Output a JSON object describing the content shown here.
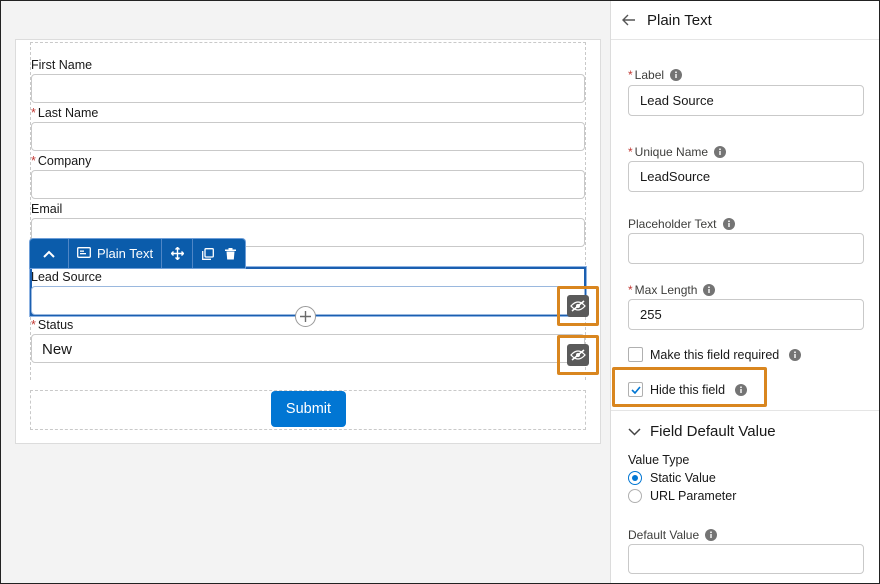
{
  "form": {
    "fields": [
      {
        "label": "First Name",
        "required": false
      },
      {
        "label": "Last Name",
        "required": true
      },
      {
        "label": "Company",
        "required": true
      },
      {
        "label": "Email",
        "required": false
      },
      {
        "label": "Lead Source",
        "required": false
      },
      {
        "label": "Status",
        "required": true,
        "value": "New"
      }
    ],
    "required_marker": "*",
    "submit_label": "Submit"
  },
  "toolbar": {
    "component_label": "Plain Text",
    "icons": [
      "chevron-up-icon",
      "text-field-icon",
      "move-icon",
      "clone-icon",
      "delete-icon"
    ]
  },
  "panel": {
    "header_title": "Plain Text",
    "label_field": {
      "label": "Label",
      "value": "Lead Source",
      "required": true
    },
    "unique_name_field": {
      "label": "Unique Name",
      "value": "LeadSource",
      "required": true
    },
    "placeholder_field": {
      "label": "Placeholder Text",
      "value": ""
    },
    "max_length_field": {
      "label": "Max Length",
      "value": "255",
      "required": true
    },
    "required_checkbox": {
      "label": "Make this field required",
      "checked": false
    },
    "hide_checkbox": {
      "label": "Hide this field",
      "checked": true
    },
    "default_section": {
      "title": "Field Default Value",
      "value_type_label": "Value Type",
      "options": [
        {
          "label": "Static Value",
          "selected": true
        },
        {
          "label": "URL Parameter",
          "selected": false
        }
      ],
      "default_value_label": "Default Value",
      "default_value": ""
    }
  },
  "colors": {
    "brand_blue": "#0176d3",
    "toolbar_blue": "#0b5cab",
    "highlight_orange": "#d9861f",
    "required_red": "#c23934"
  }
}
